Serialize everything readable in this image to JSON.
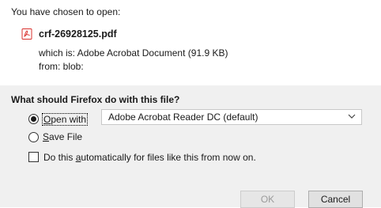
{
  "dialog": {
    "intro": "You have chosen to open:",
    "file": {
      "icon": "pdf-file-icon",
      "icon_color": "#d9302c",
      "name": "crf-26928125.pdf",
      "which_is": "which is:  Adobe Acrobat Document (91.9 KB)",
      "from": "from:  blob:"
    },
    "question": "What should Firefox do with this file?",
    "open_with": {
      "label_underline": "O",
      "label_rest": "pen with",
      "selected": true,
      "app": "Adobe Acrobat Reader DC  (default)"
    },
    "save_file": {
      "label_underline": "S",
      "label_rest": "ave File",
      "selected": false
    },
    "auto_checkbox": {
      "label_pre": "Do this ",
      "label_underline": "a",
      "label_post": "utomatically for files like this from now on.",
      "checked": false
    },
    "buttons": {
      "ok": "OK",
      "cancel": "Cancel"
    }
  }
}
